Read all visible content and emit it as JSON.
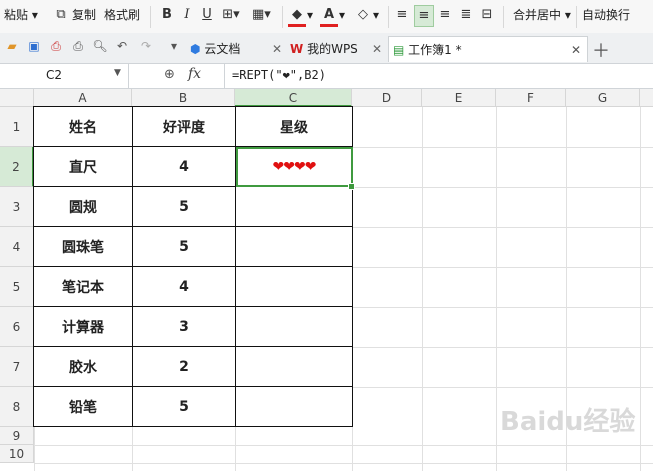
{
  "toolbar": {
    "paste_label": "粘贴",
    "copy_label": "复制",
    "format_painter_label": "格式刷",
    "bold_label": "B",
    "italic_label": "I",
    "underline_label": "U",
    "merge_label": "合并居中",
    "wrap_label": "自动换行",
    "font_color": "#e02020",
    "fill_color": "#e02020"
  },
  "tabs": [
    {
      "label": "云文档"
    },
    {
      "label": "我的WPS"
    },
    {
      "label": "工作簿1 *"
    }
  ],
  "formula_bar": {
    "cell_ref": "C2",
    "fx_label": "fx",
    "formula": "=REPT(\"❤\",B2)"
  },
  "columns": [
    "A",
    "B",
    "C",
    "D",
    "E",
    "F",
    "G"
  ],
  "rows": [
    "1",
    "2",
    "3",
    "4",
    "5",
    "6",
    "7",
    "8",
    "9",
    "10"
  ],
  "table": {
    "headers": [
      "姓名",
      "好评度",
      "星级"
    ],
    "rows": [
      {
        "name": "直尺",
        "score": "4",
        "stars": "❤❤❤❤"
      },
      {
        "name": "圆规",
        "score": "5",
        "stars": ""
      },
      {
        "name": "圆珠笔",
        "score": "5",
        "stars": ""
      },
      {
        "name": "笔记本",
        "score": "4",
        "stars": ""
      },
      {
        "name": "计算器",
        "score": "3",
        "stars": ""
      },
      {
        "name": "胶水",
        "score": "2",
        "stars": ""
      },
      {
        "name": "铅笔",
        "score": "5",
        "stars": ""
      }
    ]
  },
  "colors": {
    "selection": "#3f9a3f",
    "heart": "#e01010",
    "active_header": "#d6ead6"
  },
  "watermark": "Baidu经验"
}
